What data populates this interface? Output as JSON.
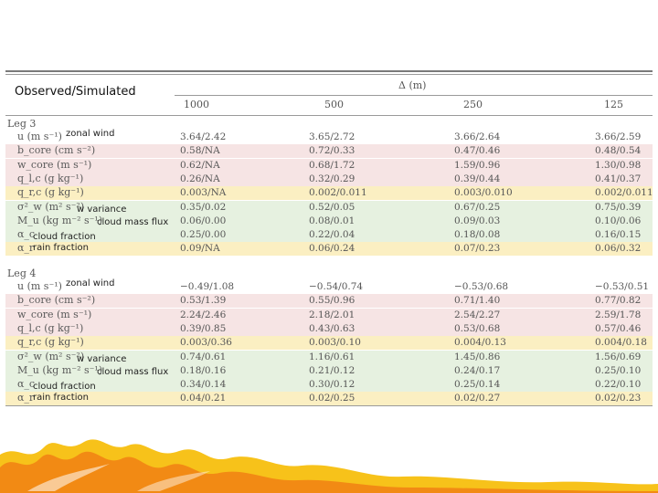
{
  "header": {
    "observed_simulated": "Observed/Simulated",
    "delta": "Δ (m)",
    "resolutions": [
      "1000",
      "500",
      "250",
      "125"
    ]
  },
  "legs": [
    {
      "title": "Leg 3",
      "rows": [
        {
          "name": "u (m s⁻¹)",
          "note": "zonal wind",
          "band": "none",
          "values": [
            "3.64/2.42",
            "3.65/2.72",
            "3.66/2.64",
            "3.66/2.59"
          ]
        },
        {
          "name": "b_core (cm s⁻²)",
          "note": "",
          "band": "pink",
          "values": [
            "0.58/NA",
            "0.72/0.33",
            "0.47/0.46",
            "0.48/0.54"
          ]
        },
        {
          "name": "w_core (m s⁻¹)",
          "note": "",
          "band": "pink",
          "values": [
            "0.62/NA",
            "0.68/1.72",
            "1.59/0.96",
            "1.30/0.98"
          ]
        },
        {
          "name": "q_l,c (g kg⁻¹)",
          "note": "",
          "band": "pink",
          "values": [
            "0.26/NA",
            "0.32/0.29",
            "0.39/0.44",
            "0.41/0.37"
          ]
        },
        {
          "name": "q_r,c (g kg⁻¹)",
          "note": "",
          "band": "yellow",
          "values": [
            "0.003/NA",
            "0.002/0.011",
            "0.003/0.010",
            "0.002/0.011"
          ]
        },
        {
          "name": "σ²_w (m² s⁻²)",
          "note": "w variance",
          "band": "green",
          "values": [
            "0.35/0.02",
            "0.52/0.05",
            "0.67/0.25",
            "0.75/0.39"
          ]
        },
        {
          "name": "M_u (kg m⁻² s⁻¹)",
          "note": "cloud mass flux",
          "band": "green",
          "values": [
            "0.06/0.00",
            "0.08/0.01",
            "0.09/0.03",
            "0.10/0.06"
          ]
        },
        {
          "name": "α_c",
          "note": "cloud fraction",
          "band": "green",
          "values": [
            "0.25/0.00",
            "0.22/0.04",
            "0.18/0.08",
            "0.16/0.15"
          ]
        },
        {
          "name": "α_r",
          "note": "rain fraction",
          "band": "yellow",
          "values": [
            "0.09/NA",
            "0.06/0.24",
            "0.07/0.23",
            "0.06/0.32"
          ]
        }
      ]
    },
    {
      "title": "Leg 4",
      "rows": [
        {
          "name": "u (m s⁻¹)",
          "note": "zonal wind",
          "band": "none",
          "values": [
            "−0.49/1.08",
            "−0.54/0.74",
            "−0.53/0.68",
            "−0.53/0.51"
          ]
        },
        {
          "name": "b_core (cm s⁻²)",
          "note": "",
          "band": "pink",
          "values": [
            "0.53/1.39",
            "0.55/0.96",
            "0.71/1.40",
            "0.77/0.82"
          ]
        },
        {
          "name": "w_core (m s⁻¹)",
          "note": "",
          "band": "pink",
          "values": [
            "2.24/2.46",
            "2.18/2.01",
            "2.54/2.27",
            "2.59/1.78"
          ]
        },
        {
          "name": "q_l,c (g kg⁻¹)",
          "note": "",
          "band": "pink",
          "values": [
            "0.39/0.85",
            "0.43/0.63",
            "0.53/0.68",
            "0.57/0.46"
          ]
        },
        {
          "name": "q_r,c (g kg⁻¹)",
          "note": "",
          "band": "yellow",
          "values": [
            "0.003/0.36",
            "0.003/0.10",
            "0.004/0.13",
            "0.004/0.18"
          ]
        },
        {
          "name": "σ²_w (m² s⁻²)",
          "note": "w variance",
          "band": "green",
          "values": [
            "0.74/0.61",
            "1.16/0.61",
            "1.45/0.86",
            "1.56/0.69"
          ]
        },
        {
          "name": "M_u (kg m⁻² s⁻¹)",
          "note": "cloud mass flux",
          "band": "green",
          "values": [
            "0.18/0.16",
            "0.21/0.12",
            "0.24/0.17",
            "0.25/0.10"
          ]
        },
        {
          "name": "α_c",
          "note": "cloud fraction",
          "band": "green",
          "values": [
            "0.34/0.14",
            "0.30/0.12",
            "0.25/0.14",
            "0.22/0.10"
          ]
        },
        {
          "name": "α_r",
          "note": "rain fraction",
          "band": "yellow",
          "values": [
            "0.04/0.21",
            "0.02/0.25",
            "0.02/0.27",
            "0.02/0.23"
          ]
        }
      ]
    }
  ],
  "colors": {
    "pink": "#f6e4e4",
    "green": "#e6f1e0",
    "yellow": "#fbefc2",
    "flame_orange": "#f28a14",
    "flame_yellow": "#f7c21a"
  }
}
